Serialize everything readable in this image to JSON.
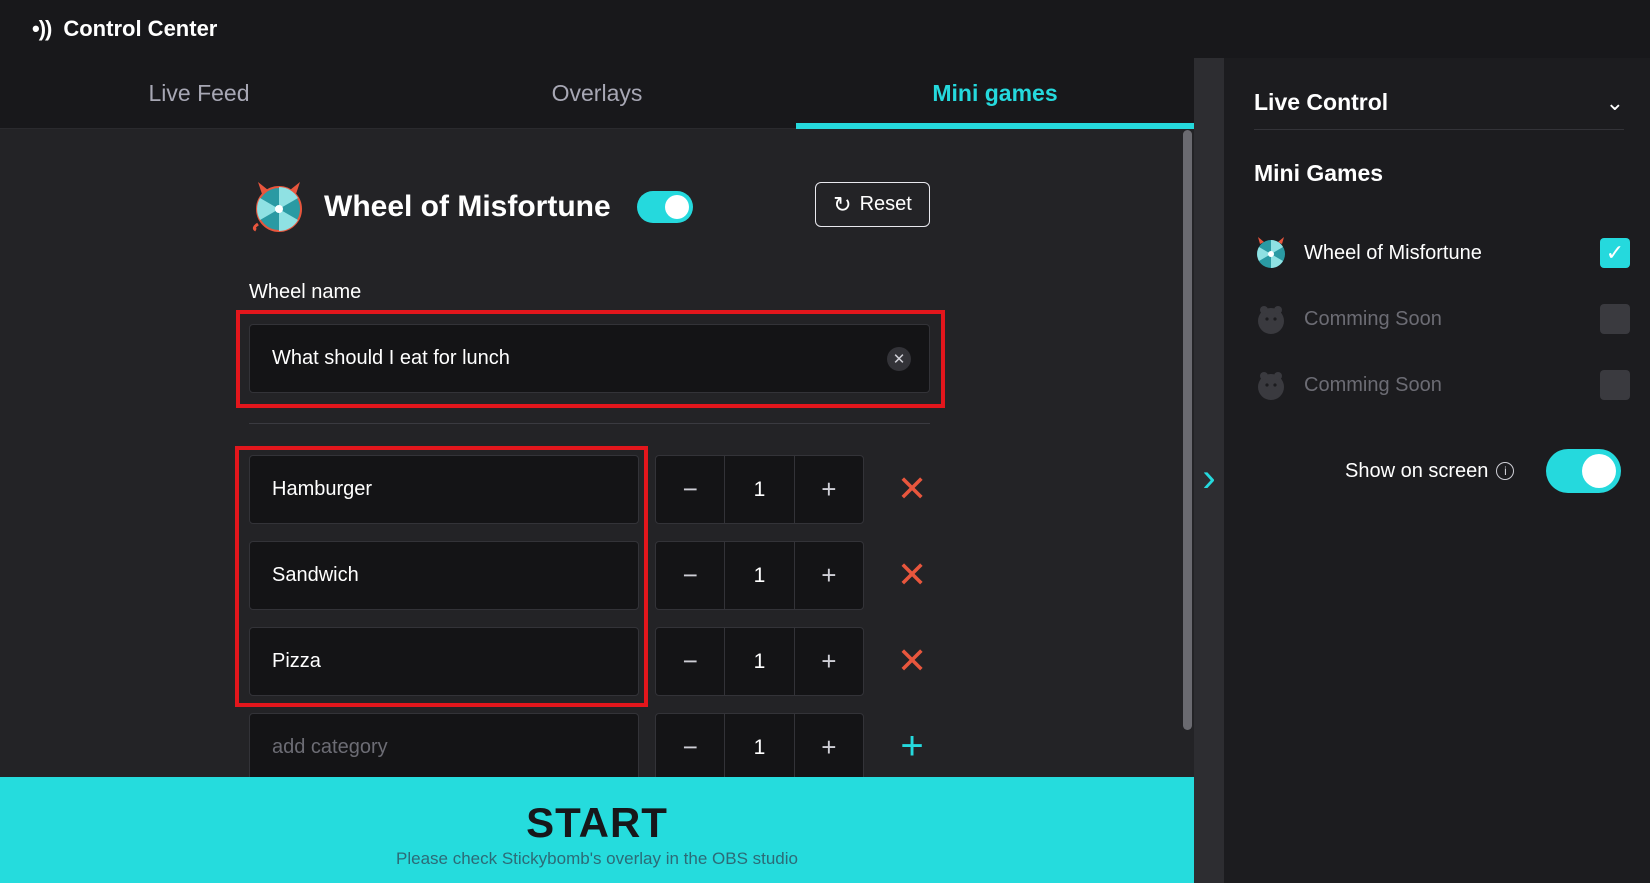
{
  "app": {
    "logo_glyph": "•))",
    "title": "Control Center"
  },
  "tabs": [
    {
      "label": "Live Feed",
      "active": false
    },
    {
      "label": "Overlays",
      "active": false
    },
    {
      "label": "Mini games",
      "active": true
    }
  ],
  "game": {
    "title": "Wheel of Misfortune",
    "enabled": true,
    "reset_label": "Reset",
    "reset_icon": "↻"
  },
  "wheel_name": {
    "label": "Wheel name",
    "value": "What should I eat for lunch",
    "clear_icon": "✕"
  },
  "categories": [
    {
      "name": "Hamburger",
      "count": "1"
    },
    {
      "name": "Sandwich",
      "count": "1"
    },
    {
      "name": "Pizza",
      "count": "1"
    }
  ],
  "new_category": {
    "placeholder": "add category",
    "count": "1"
  },
  "stepper": {
    "minus": "−",
    "plus": "+"
  },
  "icons": {
    "delete": "✕",
    "add": "+",
    "expand": "›",
    "chevron_down": "⌄",
    "check": "✓",
    "info": "i"
  },
  "start": {
    "label": "START",
    "hint": "Please check Stickybomb's overlay in the OBS studio"
  },
  "panel": {
    "title": "Live Control",
    "section": "Mini Games",
    "games": [
      {
        "name": "Wheel of Misfortune",
        "checked": true
      },
      {
        "name": "Comming Soon",
        "checked": false
      },
      {
        "name": "Comming Soon",
        "checked": false
      }
    ],
    "show_on_screen": "Show on screen",
    "show_on_screen_enabled": true
  },
  "colors": {
    "accent": "#25d9dd",
    "delete": "#e8563d",
    "highlight": "#e3161c"
  }
}
